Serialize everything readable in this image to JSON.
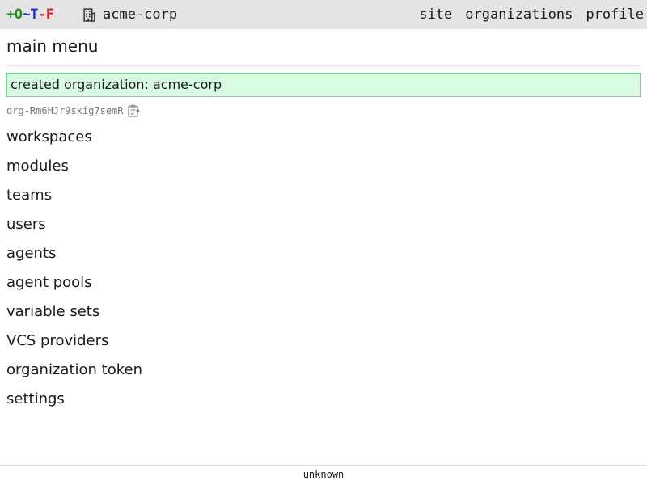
{
  "header": {
    "logo": {
      "part1": "+O",
      "sep1": "~",
      "part2": "T",
      "sep2": "-",
      "part3": "F"
    },
    "org_name": "acme-corp",
    "nav": {
      "site": "site",
      "organizations": "organizations",
      "profile": "profile"
    }
  },
  "main": {
    "title": "main menu",
    "flash_message": "created organization: acme-corp",
    "identifier": "org-Rm6HJr9sxig7semR",
    "menu_items": [
      "workspaces",
      "modules",
      "teams",
      "users",
      "agents",
      "agent pools",
      "variable sets",
      "VCS providers",
      "organization token",
      "settings"
    ]
  },
  "footer": {
    "version": "unknown"
  },
  "colors": {
    "topbar_bg": "#e4e4e4",
    "flash_bg": "#d9fbe3",
    "flash_border": "#6ed993",
    "logo_green": "#1f8a1f",
    "logo_blue": "#2632d6",
    "logo_red": "#d62626"
  },
  "icons": {
    "org": "building-icon",
    "copy": "clipboard-icon"
  }
}
